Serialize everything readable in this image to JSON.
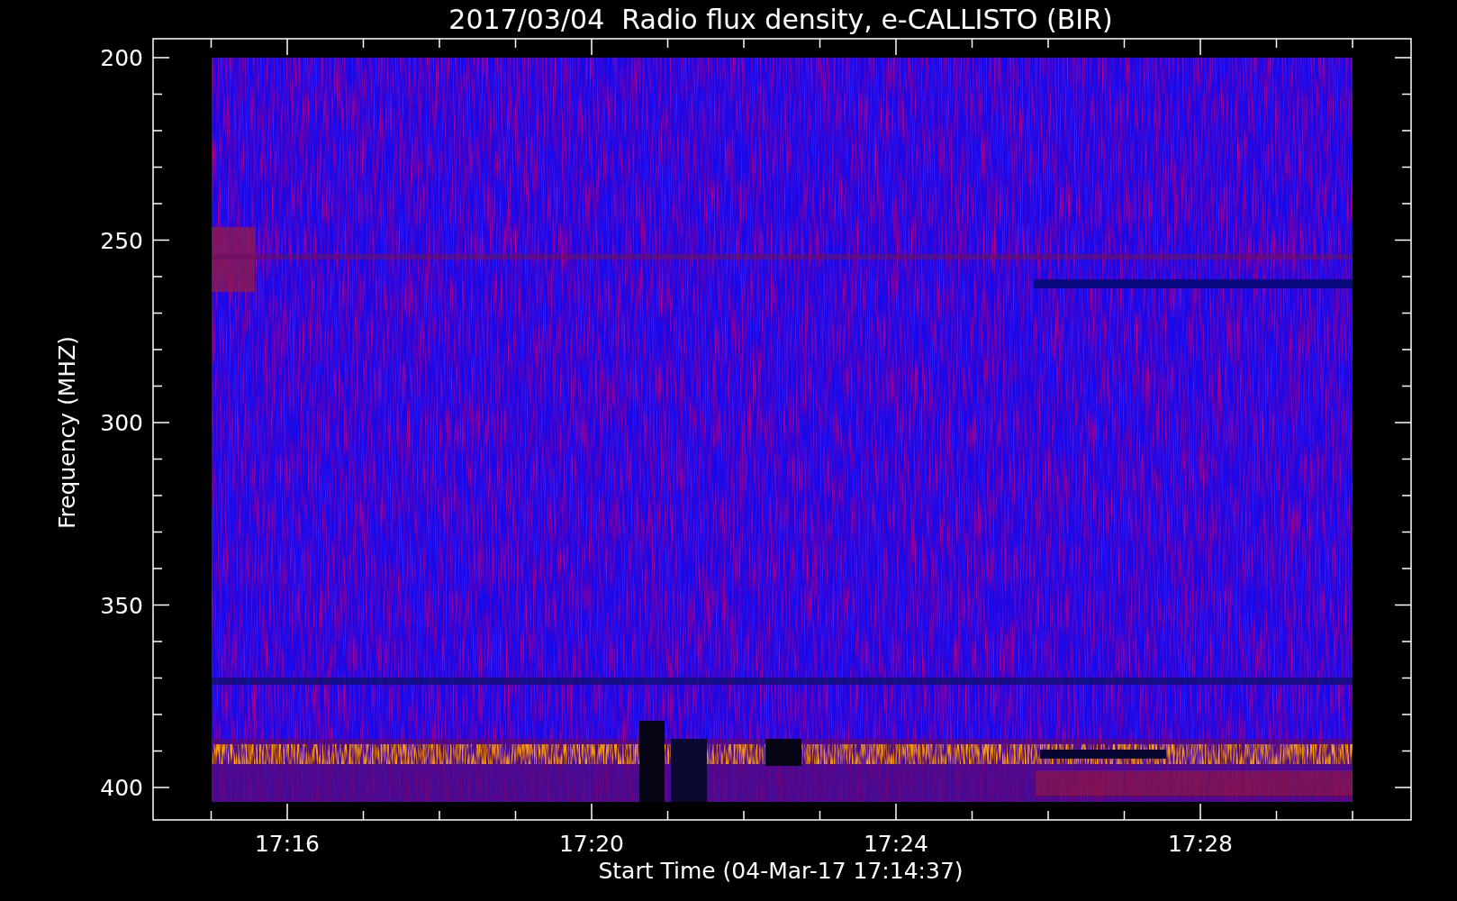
{
  "title": "2017/03/04  Radio flux density, e-CALLISTO (BIR)",
  "y_axis": {
    "label": "Frequency (MHZ)",
    "ticks": [
      "200",
      "250",
      "300",
      "350",
      "400"
    ]
  },
  "x_axis": {
    "label": "Start Time (04-Mar-17 17:14:37)",
    "ticks": [
      "17:16",
      "17:20",
      "17:24",
      "17:28"
    ]
  }
}
